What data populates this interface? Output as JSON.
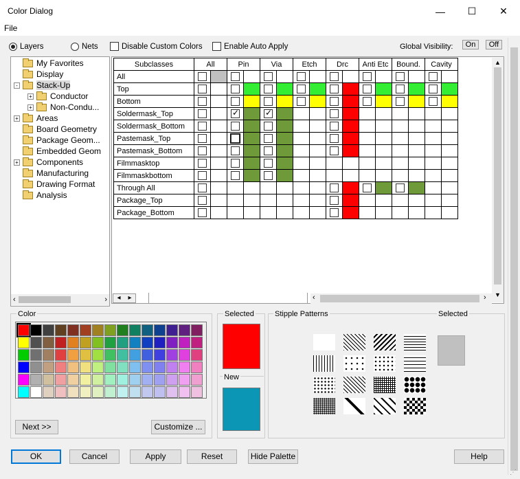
{
  "window": {
    "title": "Color Dialog"
  },
  "menu": {
    "file": "File"
  },
  "toolbar": {
    "layers": "Layers",
    "nets": "Nets",
    "disable_custom": "Disable Custom Colors",
    "enable_auto": "Enable Auto Apply",
    "global_vis": "Global Visibility:",
    "on": "On",
    "off": "Off"
  },
  "tree": [
    {
      "label": "My Favorites",
      "depth": 0,
      "exp": ""
    },
    {
      "label": "Display",
      "depth": 0,
      "exp": ""
    },
    {
      "label": "Stack-Up",
      "depth": 0,
      "exp": "-",
      "selected": true
    },
    {
      "label": "Conductor",
      "depth": 1,
      "exp": "+"
    },
    {
      "label": "Non-Condu...",
      "depth": 1,
      "exp": "+"
    },
    {
      "label": "Areas",
      "depth": 0,
      "exp": "+"
    },
    {
      "label": "Board Geometry",
      "depth": 0,
      "exp": ""
    },
    {
      "label": "Package Geom...",
      "depth": 0,
      "exp": ""
    },
    {
      "label": "Embedded Geom",
      "depth": 0,
      "exp": ""
    },
    {
      "label": "Components",
      "depth": 0,
      "exp": "+"
    },
    {
      "label": "Manufacturing",
      "depth": 0,
      "exp": ""
    },
    {
      "label": "Drawing Format",
      "depth": 0,
      "exp": ""
    },
    {
      "label": "Analysis",
      "depth": 0,
      "exp": ""
    }
  ],
  "grid": {
    "headers": [
      "Subclasses",
      "All",
      "Pin",
      "Via",
      "Etch",
      "Drc",
      "Anti Etc",
      "Bound.",
      "Cavity"
    ],
    "rows": [
      "All",
      "Top",
      "Bottom",
      "Soldermask_Top",
      "Soldermask_Bottom",
      "Pastemask_Top",
      "Pastemask_Bottom",
      "Filmmasktop",
      "Filmmaskbottom",
      "Through All",
      "Package_Top",
      "Package_Bottom"
    ]
  },
  "colors": {
    "green": "#33ee33",
    "yellow": "#ffff00",
    "olive": "#6e9a3a",
    "red": "#ff0000",
    "gray": "#c0c0c0",
    "new": "#0b96b6"
  },
  "color_panel": {
    "title": "Color",
    "next": "Next >>",
    "customize": "Customize ...",
    "palette": [
      [
        "#ff0000",
        "#000000",
        "#404040",
        "#604020",
        "#803020",
        "#a04020",
        "#a08020",
        "#80a020",
        "#208020",
        "#108060",
        "#106080",
        "#104090",
        "#402090",
        "#602080",
        "#802060"
      ],
      [
        "#ffff00",
        "#505050",
        "#806040",
        "#c02020",
        "#e08020",
        "#c0a020",
        "#80c020",
        "#20a040",
        "#20a080",
        "#1080c0",
        "#1040c0",
        "#2020c0",
        "#8020c0",
        "#c020c0",
        "#c02080"
      ],
      [
        "#00cc00",
        "#707070",
        "#a08060",
        "#e04040",
        "#f0a040",
        "#e0c040",
        "#a0e040",
        "#40c060",
        "#40c0a0",
        "#40a0e0",
        "#4060e0",
        "#4040e0",
        "#a040e0",
        "#e040e0",
        "#e04080"
      ],
      [
        "#0000ff",
        "#909090",
        "#c0a080",
        "#f08080",
        "#f0c080",
        "#f0e080",
        "#c0f080",
        "#80e0a0",
        "#80e0c0",
        "#80c0f0",
        "#8090f0",
        "#8080f0",
        "#c080f0",
        "#f080f0",
        "#f080c0"
      ],
      [
        "#ff00ff",
        "#b0b0b0",
        "#d0c0a0",
        "#f0a0a0",
        "#f0d0a0",
        "#f0f0a0",
        "#d0f0a0",
        "#a0f0c0",
        "#a0f0e0",
        "#a0d0f0",
        "#a0b0f0",
        "#a0a0f0",
        "#d0a0f0",
        "#f0a0f0",
        "#f0a0d0"
      ],
      [
        "#00ffff",
        "#ffffff",
        "#e0d0c0",
        "#f0c0c0",
        "#f0e0c0",
        "#f0f0c0",
        "#e0f0c0",
        "#c0f0d0",
        "#c0f0f0",
        "#c0e0f0",
        "#c0c8f0",
        "#c0c0f0",
        "#e0c0f0",
        "#f0c0f0",
        "#f0c0e0"
      ]
    ]
  },
  "selected_panel": {
    "selected": "Selected",
    "new": "New"
  },
  "stipple": {
    "title": "Stipple Patterns",
    "selected": "Selected"
  },
  "buttons": {
    "ok": "OK",
    "cancel": "Cancel",
    "apply": "Apply",
    "reset": "Reset",
    "hide": "Hide Palette",
    "help": "Help"
  }
}
